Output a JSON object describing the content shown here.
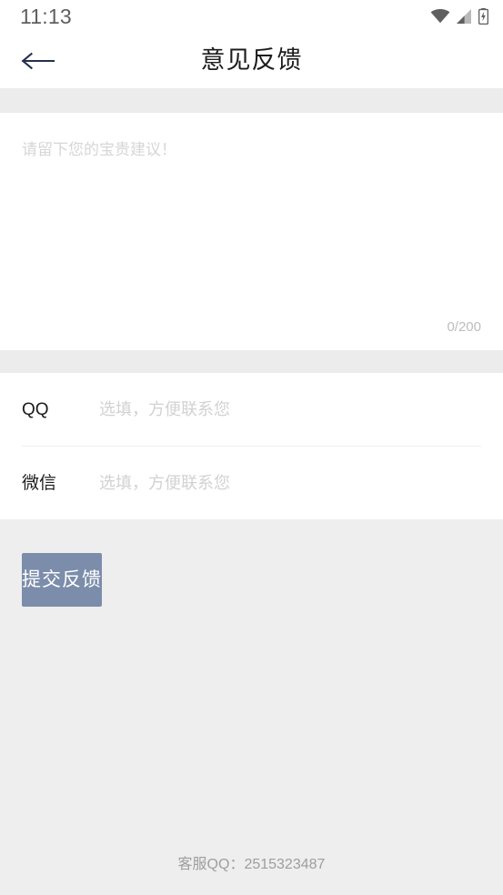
{
  "status_bar": {
    "time": "11:13",
    "icons": [
      "wifi-icon",
      "cellular-signal-icon",
      "battery-charging-icon"
    ]
  },
  "title_bar": {
    "back_icon": "arrow-left-icon",
    "title": "意见反馈"
  },
  "feedback": {
    "placeholder": "请留下您的宝贵建议！",
    "value": "",
    "counter": "0/200",
    "max_length": 200
  },
  "contacts": [
    {
      "label": "QQ",
      "placeholder": "选填，方便联系您",
      "value": "",
      "name": "qq"
    },
    {
      "label": "微信",
      "placeholder": "选填，方便联系您",
      "value": "",
      "name": "wechat"
    }
  ],
  "submit": {
    "label": "提交反馈"
  },
  "footer": {
    "note": "客服QQ：2515323487"
  },
  "colors": {
    "page_background": "#eeeeee",
    "card_background": "#ffffff",
    "band": "#ececec",
    "title_text": "#1c1c1c",
    "back_arrow": "#25304d",
    "placeholder": "#d6d6d6",
    "counter_text": "#bdbdbd",
    "submit_background": "#7b8daa",
    "submit_text": "#ffffff",
    "footer_text": "#9e9e9e",
    "divider": "#eeeeee",
    "status_time": "#5f5f5f",
    "status_icon": "#5f5f5f"
  }
}
